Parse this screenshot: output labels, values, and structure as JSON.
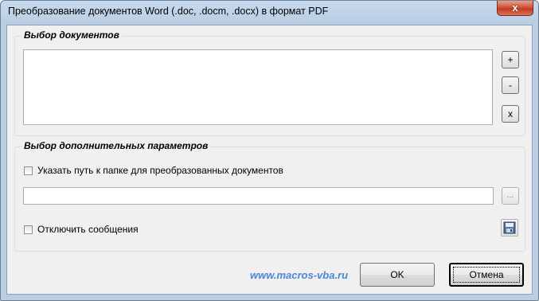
{
  "window": {
    "title": "Преобразование документов Word (.doc, .docm, .docx) в формат PDF",
    "close_glyph": "x"
  },
  "documents_group": {
    "title": "Выбор документов",
    "add_label": "+",
    "remove_label": "-",
    "clear_label": "x"
  },
  "options_group": {
    "title": "Выбор дополнительных параметров",
    "folder_checkbox_label": "Указать путь к папке для преобразованных документов",
    "folder_checked": false,
    "folder_path_value": "",
    "browse_label": "...",
    "messages_checkbox_label": "Отключить сообщения",
    "messages_checked": false
  },
  "footer": {
    "link_text": "www.macros-vba.ru",
    "ok_label": "OK",
    "cancel_label": "Отмена"
  },
  "colors": {
    "link": "#4a86d8",
    "close_button": "#c23b22"
  },
  "icons": [
    "close-icon",
    "floppy-save-icon"
  ]
}
